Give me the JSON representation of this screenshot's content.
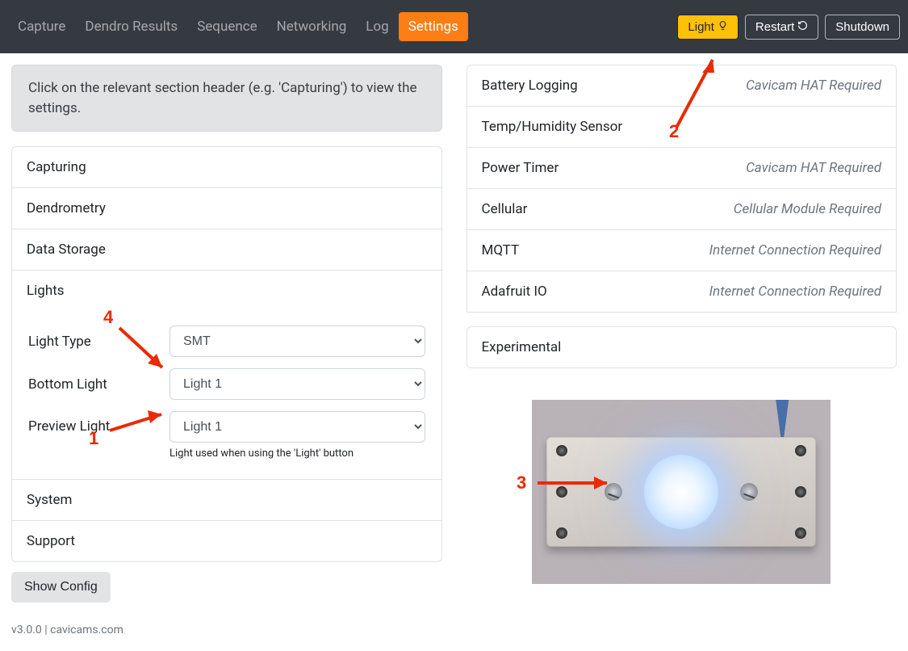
{
  "nav": {
    "items": [
      "Capture",
      "Dendro Results",
      "Sequence",
      "Networking",
      "Log",
      "Settings"
    ],
    "active_index": 5
  },
  "topbar_buttons": {
    "light": "Light",
    "restart": "Restart",
    "shutdown": "Shutdown"
  },
  "hint_text": "Click on the relevant section header (e.g. 'Capturing') to view the settings.",
  "left_sections": {
    "capturing": "Capturing",
    "dendrometry": "Dendrometry",
    "data_storage": "Data Storage",
    "lights": "Lights",
    "system": "System",
    "support": "Support"
  },
  "lights_form": {
    "light_type": {
      "label": "Light Type",
      "value": "SMT"
    },
    "bottom_light": {
      "label": "Bottom Light",
      "value": "Light 1"
    },
    "preview_light": {
      "label": "Preview Light",
      "value": "Light 1",
      "help": "Light used when using the 'Light' button"
    }
  },
  "right_sections": [
    {
      "label": "Battery Logging",
      "note": "Cavicam HAT Required"
    },
    {
      "label": "Temp/Humidity Sensor",
      "note": ""
    },
    {
      "label": "Power Timer",
      "note": "Cavicam HAT Required"
    },
    {
      "label": "Cellular",
      "note": "Cellular Module Required"
    },
    {
      "label": "MQTT",
      "note": "Internet Connection Required"
    },
    {
      "label": "Adafruit IO",
      "note": "Internet Connection Required"
    },
    {
      "label": "Experimental",
      "note": ""
    }
  ],
  "show_config": "Show Config",
  "footer": "v3.0.0 | cavicams.com",
  "annotations": {
    "a1": "1",
    "a2": "2",
    "a3": "3",
    "a4": "4"
  }
}
